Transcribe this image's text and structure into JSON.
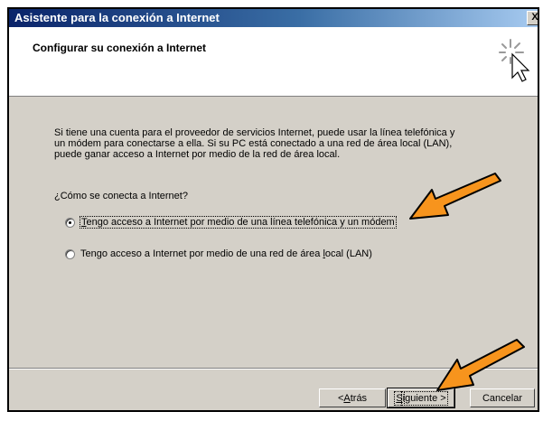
{
  "window": {
    "title": "Asistente para la conexión a Internet",
    "close_glyph": "X"
  },
  "header": {
    "title": "Configurar su conexión a Internet",
    "icon": "wizard-wand-icon"
  },
  "description_lines": [
    "Si tiene una cuenta para el proveedor de servicios Internet, puede usar la línea telefónica y",
    "un módem para conectarse a ella. Si su PC está conectado a una red de área local (LAN),",
    "puede ganar acceso a Internet por medio de la red de área local."
  ],
  "question": "¿Cómo se conecta a Internet?",
  "options": [
    {
      "access_key": "T",
      "rest": "engo acceso a Internet por medio de una línea telefónica y un módem",
      "selected": true
    },
    {
      "before": "Tengo acceso a Internet por medio de una red de área ",
      "access_key": "l",
      "after": "ocal (LAN)",
      "selected": false
    }
  ],
  "buttons": {
    "back": {
      "prefix": "< ",
      "access_key": "A",
      "rest": "trás"
    },
    "next": {
      "access_key": "S",
      "rest": "iguiente >"
    },
    "cancel": "Cancelar"
  },
  "annotation_color": "#f7941d"
}
